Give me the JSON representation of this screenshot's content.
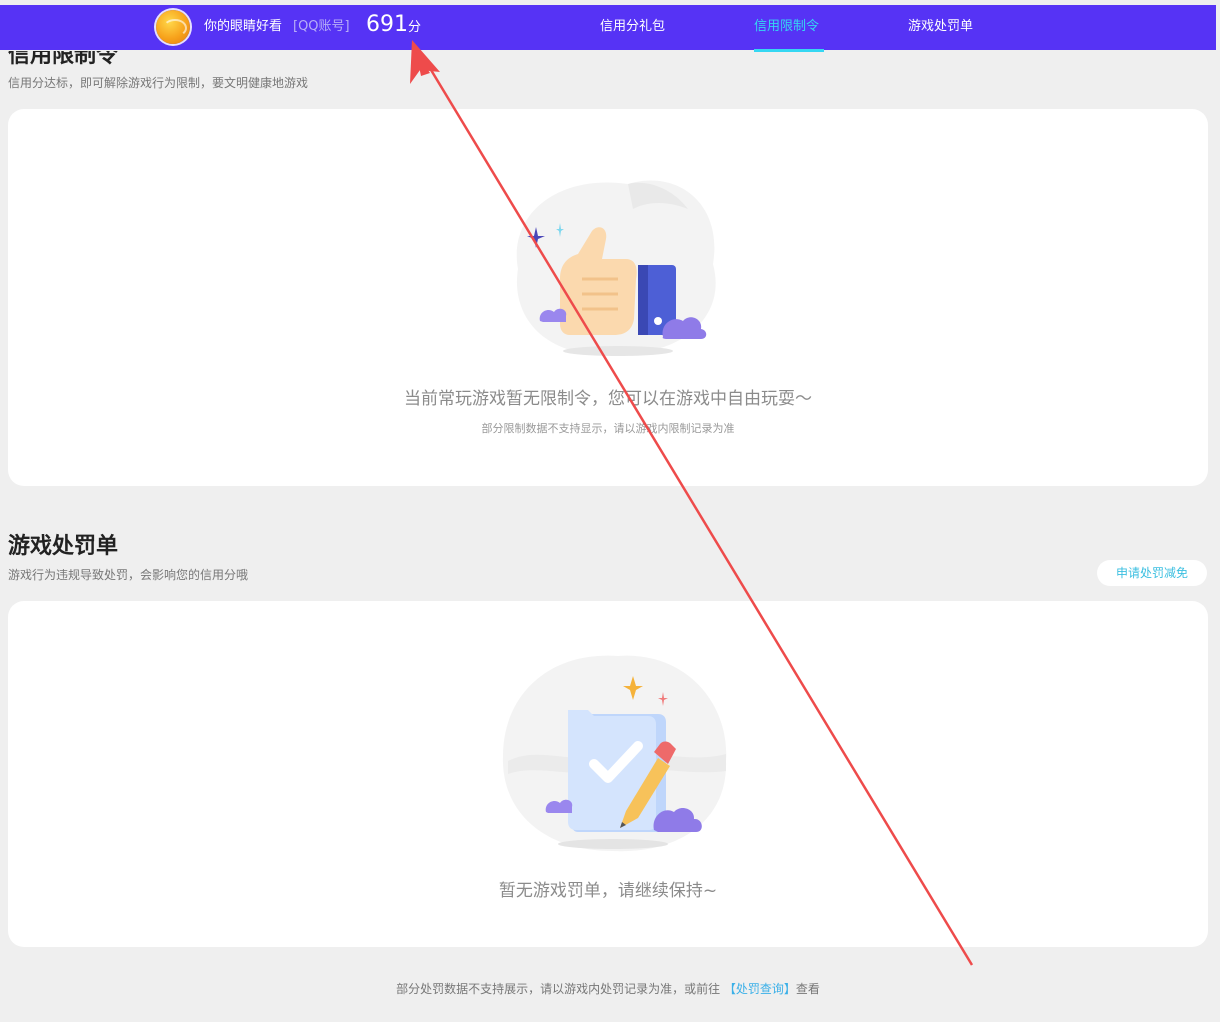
{
  "header": {
    "nickname": "你的眼睛好看",
    "account_type": "[QQ账号]",
    "score": "691",
    "score_unit": "分",
    "nav": [
      {
        "label": "信用分礼包",
        "active": false
      },
      {
        "label": "信用限制令",
        "active": true
      },
      {
        "label": "游戏处罚单",
        "active": false
      }
    ],
    "colors": {
      "bar": "#5633f5",
      "active": "#35d7f2"
    }
  },
  "restriction": {
    "title": "信用限制令",
    "subtitle": "信用分达标，即可解除游戏行为限制，要文明健康地游戏",
    "empty_message": "当前常玩游戏暂无限制令，您可以在游戏中自由玩耍～",
    "note": "部分限制数据不支持显示，请以游戏内限制记录为准",
    "illustration_icon": "thumbs-up-icon"
  },
  "penalty": {
    "title": "游戏处罚单",
    "subtitle": "游戏行为违规导致处罚，会影响您的信用分哦",
    "appeal_button": "申请处罚减免",
    "empty_message": "暂无游戏罚单，请继续保持~",
    "illustration_icon": "checklist-pencil-icon"
  },
  "footer": {
    "text_before": "部分处罚数据不支持展示，请以游戏内处罚记录为准，或前往",
    "link": "【处罚查询】",
    "text_after": "查看"
  }
}
